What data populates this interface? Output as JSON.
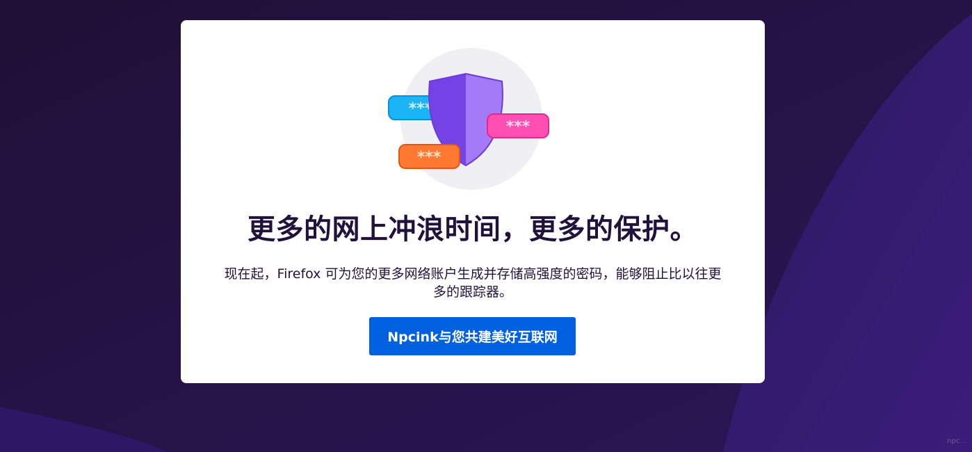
{
  "dialog": {
    "headline": "更多的网上冲浪时间，更多的保护。",
    "body": "现在起，Firefox 可为您的更多网络账户生成并存储高强度的密码，能够阻止比以往更多的跟踪器。",
    "button_label": "Npcink与您共建美好互联网"
  },
  "illustration": {
    "icons": [
      "shield-icon",
      "password-badge-blue",
      "password-badge-pink",
      "password-badge-orange"
    ],
    "badge_text": "***"
  },
  "watermark": {
    "text": "npc..."
  },
  "colors": {
    "background": "#21113f",
    "card": "#ffffff",
    "headline": "#20123a",
    "button": "#0061e0",
    "button_text": "#ffffff",
    "shield_left": "#7542e5",
    "shield_right": "#a47bf7",
    "badge_blue": "#1bb4f5",
    "badge_pink": "#ff4fb2",
    "badge_orange": "#ff7a30"
  }
}
